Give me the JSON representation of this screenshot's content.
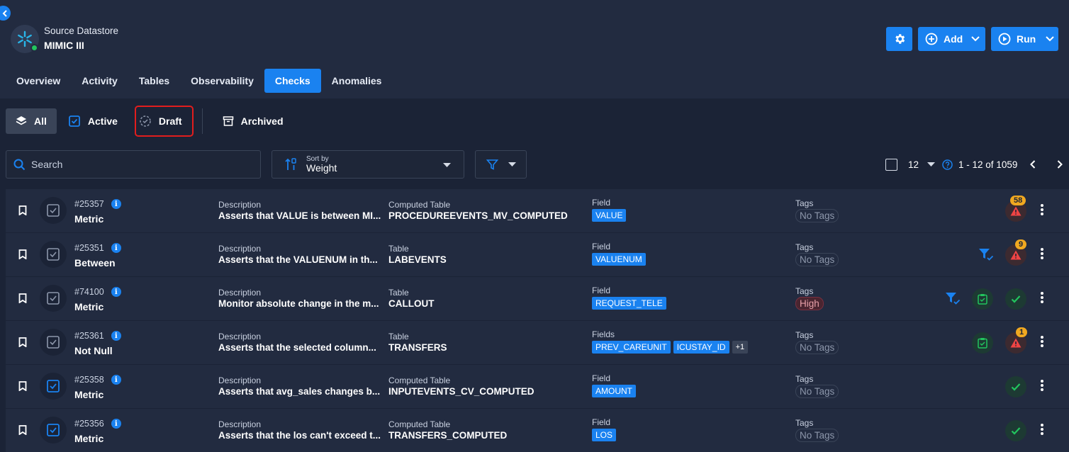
{
  "datastore": {
    "subtitle": "Source Datastore",
    "title": "MIMIC III"
  },
  "actions": {
    "add_label": "Add",
    "run_label": "Run"
  },
  "tabs": [
    "Overview",
    "Activity",
    "Tables",
    "Observability",
    "Checks",
    "Anomalies"
  ],
  "status_tabs": {
    "all": "All",
    "active": "Active",
    "draft": "Draft",
    "archived": "Archived"
  },
  "search": {
    "placeholder": "Search"
  },
  "sort": {
    "label": "Sort by",
    "value": "Weight"
  },
  "pagination": {
    "page_size": "12",
    "range": "1 - 12 of 1059"
  },
  "colors": {
    "accent": "#1a82f0",
    "bg": "#1b2336",
    "row": "#222b40",
    "danger": "#ef4444",
    "success": "#22c55e",
    "warning": "#f0a820"
  },
  "rows": [
    {
      "id": "#25357",
      "type": "Metric",
      "desc_label": "Description",
      "desc": "Asserts that VALUE is between MI...",
      "table_label": "Computed Table",
      "table": "PROCEDUREEVENTS_MV_COMPUTED",
      "field_label": "Field",
      "fields": [
        "VALUE"
      ],
      "tags_label": "Tags",
      "tag": "No Tags",
      "anomalies": "58"
    },
    {
      "id": "#25351",
      "type": "Between",
      "desc_label": "Description",
      "desc": "Asserts that the VALUENUM in th...",
      "table_label": "Table",
      "table": "LABEVENTS",
      "field_label": "Field",
      "fields": [
        "VALUENUM"
      ],
      "tags_label": "Tags",
      "tag": "No Tags",
      "anomalies": "9"
    },
    {
      "id": "#74100",
      "type": "Metric",
      "desc_label": "Description",
      "desc": "Monitor absolute change in the m...",
      "table_label": "Table",
      "table": "CALLOUT",
      "field_label": "Field",
      "fields": [
        "REQUEST_TELE"
      ],
      "tags_label": "Tags",
      "tag": "High"
    },
    {
      "id": "#25361",
      "type": "Not Null",
      "desc_label": "Description",
      "desc": "Asserts that the selected column...",
      "table_label": "Table",
      "table": "TRANSFERS",
      "field_label": "Fields",
      "fields": [
        "PREV_CAREUNIT",
        "ICUSTAY_ID"
      ],
      "more": "+1",
      "tags_label": "Tags",
      "tag": "No Tags",
      "anomalies": "1"
    },
    {
      "id": "#25358",
      "type": "Metric",
      "desc_label": "Description",
      "desc": "Asserts that avg_sales changes b...",
      "table_label": "Computed Table",
      "table": "INPUTEVENTS_CV_COMPUTED",
      "field_label": "Field",
      "fields": [
        "AMOUNT"
      ],
      "tags_label": "Tags",
      "tag": "No Tags"
    },
    {
      "id": "#25356",
      "type": "Metric",
      "desc_label": "Description",
      "desc": "Asserts that the los can't exceed t...",
      "table_label": "Computed Table",
      "table": "TRANSFERS_COMPUTED",
      "field_label": "Field",
      "fields": [
        "LOS"
      ],
      "tags_label": "Tags",
      "tag": "No Tags"
    }
  ]
}
